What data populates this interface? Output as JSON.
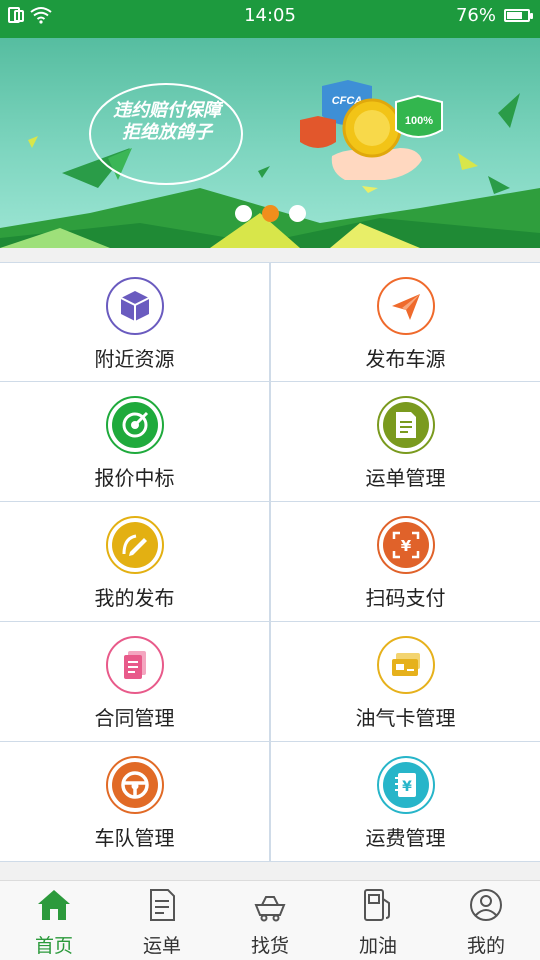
{
  "status_bar": {
    "time": "14:05",
    "battery": "76%",
    "battery_level": 0.76,
    "icons": [
      "sim-icon",
      "wifi-icon",
      "battery-icon"
    ]
  },
  "banner": {
    "headline_1": "违约赔付保障",
    "headline_2": "拒绝放鸽子",
    "badges": [
      "CFCA",
      "100%"
    ],
    "slide_count": 3,
    "active_slide": 2
  },
  "grid": {
    "items": [
      {
        "label": "附近资源",
        "icon": "cube-icon",
        "color": "#6a5bbf"
      },
      {
        "label": "发布车源",
        "icon": "paper-plane-icon",
        "color": "#ef6a2c"
      },
      {
        "label": "报价中标",
        "icon": "target-icon",
        "color": "#1faa3c"
      },
      {
        "label": "运单管理",
        "icon": "document-icon",
        "color": "#7a9a1e"
      },
      {
        "label": "我的发布",
        "icon": "edit-icon",
        "color": "#e3b012"
      },
      {
        "label": "扫码支付",
        "icon": "scan-pay-icon",
        "color": "#e0622a"
      },
      {
        "label": "合同管理",
        "icon": "contract-icon",
        "color": "#e85a8a"
      },
      {
        "label": "油气卡管理",
        "icon": "fuel-card-icon",
        "color": "#e6b11c"
      },
      {
        "label": "车队管理",
        "icon": "steering-wheel-icon",
        "color": "#e16a26"
      },
      {
        "label": "运费管理",
        "icon": "freight-fee-icon",
        "color": "#27b5c9"
      }
    ]
  },
  "bottom_nav": {
    "items": [
      {
        "label": "首页",
        "icon": "home-icon",
        "active": true
      },
      {
        "label": "运单",
        "icon": "waybill-icon",
        "active": false
      },
      {
        "label": "找货",
        "icon": "find-goods-icon",
        "active": false
      },
      {
        "label": "加油",
        "icon": "fuel-pump-icon",
        "active": false
      },
      {
        "label": "我的",
        "icon": "profile-icon",
        "active": false
      }
    ],
    "active_color": "#2c9a3c"
  }
}
